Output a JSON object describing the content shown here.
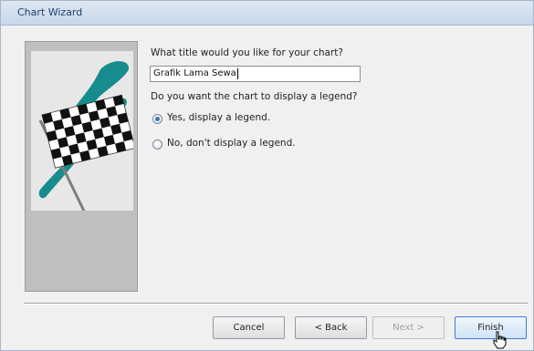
{
  "window": {
    "title": "Chart Wizard"
  },
  "form": {
    "title_prompt": "What title would you like for your chart?",
    "title_value": "Grafik Lama Sewa",
    "legend_prompt": "Do you want the chart to display a legend?",
    "legend_options": [
      {
        "label": "Yes, display a legend.",
        "selected": true
      },
      {
        "label": "No, don't display a legend.",
        "selected": false
      }
    ]
  },
  "buttons": {
    "cancel": "Cancel",
    "back": "< Back",
    "next": "Next >",
    "finish": "Finish"
  },
  "colors": {
    "flag_accent": "#168c8e",
    "focus_border": "#3d7bd6"
  },
  "icons": {
    "art": "checkered-flag-illustration",
    "cursor": "hand-pointer"
  }
}
